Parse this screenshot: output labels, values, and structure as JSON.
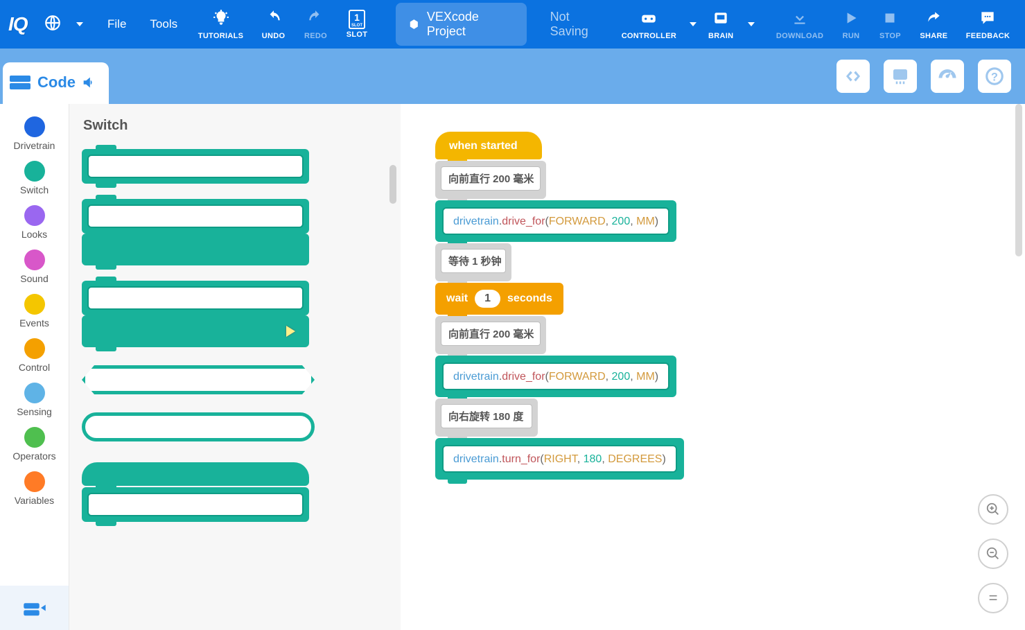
{
  "topbar": {
    "logo": "IQ",
    "file": "File",
    "tools": "Tools",
    "tutorials": "TUTORIALS",
    "undo": "UNDO",
    "redo": "REDO",
    "slot_label": "SLOT",
    "slot_number": "1",
    "project_name": "VEXcode Project",
    "not_saving": "Not Saving",
    "controller": "CONTROLLER",
    "brain": "BRAIN",
    "download": "DOWNLOAD",
    "run": "RUN",
    "stop": "STOP",
    "share": "SHARE",
    "feedback": "FEEDBACK"
  },
  "subbar": {
    "code_tab": "Code"
  },
  "categories": [
    {
      "name": "Drivetrain",
      "color": "#1f66e0"
    },
    {
      "name": "Switch",
      "color": "#18b29a"
    },
    {
      "name": "Looks",
      "color": "#9a67f0"
    },
    {
      "name": "Sound",
      "color": "#d857c9"
    },
    {
      "name": "Events",
      "color": "#f4c600"
    },
    {
      "name": "Control",
      "color": "#f4a000"
    },
    {
      "name": "Sensing",
      "color": "#5fb3e6"
    },
    {
      "name": "Operators",
      "color": "#4fbf4f"
    },
    {
      "name": "Variables",
      "color": "#ff7b26"
    }
  ],
  "palette": {
    "title": "Switch"
  },
  "script": {
    "hat": "when started",
    "blocks": [
      {
        "kind": "comment",
        "text": "向前直行 200 毫米"
      },
      {
        "kind": "code",
        "obj": "drivetrain",
        "fn": "drive_for",
        "args": [
          "FORWARD",
          "200",
          "MM"
        ]
      },
      {
        "kind": "comment",
        "text": "等待 1 秒钟"
      },
      {
        "kind": "wait",
        "label_before": "wait",
        "value": "1",
        "label_after": "seconds"
      },
      {
        "kind": "comment",
        "text": "向前直行 200 毫米"
      },
      {
        "kind": "code",
        "obj": "drivetrain",
        "fn": "drive_for",
        "args": [
          "FORWARD",
          "200",
          "MM"
        ]
      },
      {
        "kind": "comment",
        "text": "向右旋转 180 度"
      },
      {
        "kind": "code",
        "obj": "drivetrain",
        "fn": "turn_for",
        "args": [
          "RIGHT",
          "180",
          "DEGREES"
        ]
      }
    ]
  }
}
